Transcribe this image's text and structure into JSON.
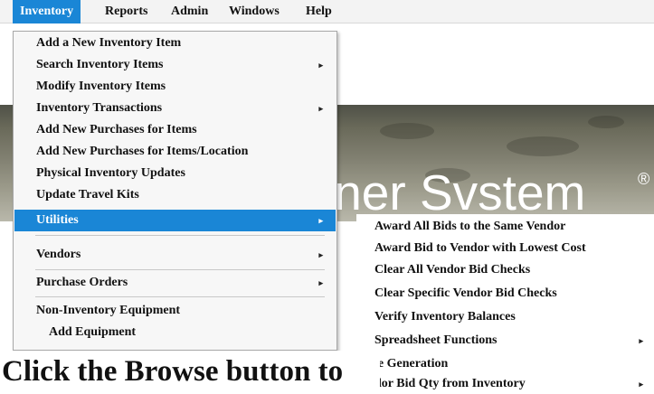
{
  "menubar": {
    "items": [
      "Inventory",
      "Reports",
      "Admin",
      "Windows",
      "Help"
    ]
  },
  "banner": {
    "title": "iner Svstem",
    "reg": "®"
  },
  "dropdown": {
    "items": [
      {
        "label": "Add a New Inventory Item",
        "arrow": ""
      },
      {
        "label": "Search Inventory Items",
        "arrow": "▸"
      },
      {
        "label": "Modify Inventory Items",
        "arrow": ""
      },
      {
        "label": "Inventory Transactions",
        "arrow": "▸"
      },
      {
        "label": "Add New Purchases for Items",
        "arrow": ""
      },
      {
        "label": "Add New Purchases for Items/Location",
        "arrow": ""
      },
      {
        "label": "Physical Inventory Updates",
        "arrow": ""
      },
      {
        "label": "Update Travel Kits",
        "arrow": ""
      },
      {
        "label": "Utilities",
        "arrow": "▸"
      },
      {
        "label": "Vendors",
        "arrow": "▸"
      },
      {
        "label": "Purchase Orders",
        "arrow": "▸"
      },
      {
        "label": "Non-Inventory Equipment",
        "arrow": ""
      },
      {
        "label": "Add Equipment",
        "arrow": ""
      }
    ]
  },
  "submenu": {
    "items": [
      {
        "label": "Award All Bids to the Same Vendor",
        "arrow": ""
      },
      {
        "label": "Award Bid to Vendor with Lowest Cost",
        "arrow": ""
      },
      {
        "label": "Clear All Vendor Bid Checks",
        "arrow": ""
      },
      {
        "label": "Clear Specific Vendor Bid Checks",
        "arrow": ""
      },
      {
        "label": "Verify Inventory Balances",
        "arrow": ""
      },
      {
        "label": "Spreadsheet Functions",
        "arrow": "▸"
      },
      {
        "label": "le Generation",
        "arrow": ""
      },
      {
        "label": "dor Bid Qty from Inventory",
        "arrow": "▸"
      }
    ]
  },
  "instruction": {
    "text": "Click the Browse button to"
  }
}
